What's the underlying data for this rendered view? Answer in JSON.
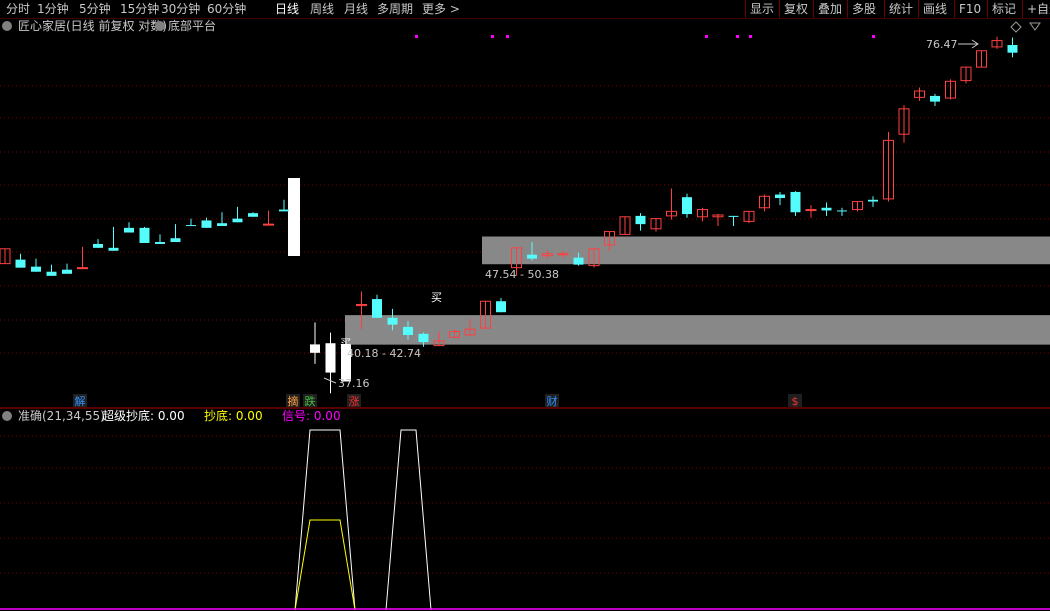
{
  "toolbar": {
    "periods": [
      "分时",
      "1分钟",
      "5分钟",
      "15分钟",
      "30分钟",
      "60分钟",
      "日线",
      "周线",
      "月线",
      "多周期",
      "更多 >"
    ],
    "active_period": "日线",
    "right_buttons": [
      "显示",
      "复权",
      "叠加",
      "多股",
      "统计",
      "画线",
      "F10",
      "标记",
      "+自选"
    ]
  },
  "main_panel": {
    "title": "匠心家居(日线 前复权 对数)",
    "indicator_name": "底部平台",
    "max_label": "76.47",
    "min_label": "37.16",
    "zone_upper_label": "47.54 - 50.38",
    "zone_lower_label": "40.18 - 42.74",
    "buy_marker": "买",
    "event_markers": [
      "解",
      "摘",
      "跌",
      "涨",
      "财",
      "$"
    ]
  },
  "sub_panel": {
    "indicator": "准确(21,34,55)",
    "values": [
      {
        "name": "超级抄底:",
        "value": "0.00",
        "color": "#ffffff"
      },
      {
        "name": "抄底:",
        "value": "0.00",
        "color": "#ffff00"
      },
      {
        "name": "信号:",
        "value": "0.00",
        "color": "#ff00ff"
      }
    ]
  },
  "colors": {
    "up": "#ff4040",
    "down": "#54fcfc",
    "zone": "#888888",
    "magenta": "#ff00ff",
    "grid": "#7a0000",
    "border": "#b00000",
    "cyan": "#54fcfc"
  },
  "chart_data": {
    "type": "candlestick",
    "candles": [
      [
        47.6,
        48.3,
        49.1,
        47.9
      ],
      [
        48.0,
        48.6,
        47.2,
        47.4
      ],
      [
        47.3,
        48.1,
        46.8,
        46.8
      ],
      [
        46.8,
        47.5,
        46.4,
        47.3
      ],
      [
        47.0,
        47.6,
        46.6,
        47.1
      ],
      [
        47.2,
        49.3,
        47.2,
        49.3
      ],
      [
        49.6,
        50.1,
        49.2,
        49.3
      ],
      [
        49.2,
        51.4,
        48.9,
        51.3
      ],
      [
        51.3,
        51.9,
        50.8,
        51.6
      ],
      [
        51.3,
        51.4,
        49.7,
        50.2
      ],
      [
        49.8,
        50.6,
        49.6,
        50.2
      ],
      [
        50.2,
        51.7,
        49.8,
        51.7
      ],
      [
        51.6,
        52.3,
        51.5,
        52.3
      ],
      [
        52.1,
        52.4,
        51.3,
        52.0
      ],
      [
        51.8,
        53.0,
        51.5,
        52.6
      ],
      [
        52.3,
        53.6,
        51.9,
        52.9
      ],
      [
        52.9,
        53.0,
        52.5,
        53.0
      ],
      [
        51.7,
        53.2,
        51.7,
        53.2
      ],
      [
        53.3,
        54.4,
        53.1,
        54.4
      ],
      [
        40.2,
        42.1,
        39.5,
        38.6
      ],
      [
        40.3,
        41.2,
        37.9,
        36.3
      ],
      [
        40.2,
        40.5,
        37.2,
        37.6
      ],
      [
        43.6,
        44.9,
        43.7,
        41.5
      ],
      [
        44.2,
        44.6,
        42.5,
        42.5
      ],
      [
        42.5,
        43.3,
        41.9,
        41.4
      ],
      [
        41.7,
        42.2,
        41.0,
        40.6
      ],
      [
        41.1,
        41.2,
        40.4,
        40.0
      ],
      [
        40.1,
        41.3,
        40.5,
        40.4
      ],
      [
        40.8,
        41.5,
        41.3,
        41.2
      ],
      [
        41.0,
        42.4,
        41.5,
        41.4
      ],
      [
        41.6,
        44.0,
        44.0,
        41.5
      ],
      [
        44.0,
        44.3,
        43.0,
        43.1
      ],
      [
        47.2,
        48.0,
        49.2,
        46.4
      ],
      [
        48.5,
        49.8,
        48.1,
        47.9
      ],
      [
        48.4,
        48.9,
        48.6,
        48.1
      ],
      [
        48.6,
        48.9,
        48.6,
        48.2
      ],
      [
        48.2,
        48.7,
        47.5,
        47.4
      ],
      [
        47.4,
        49.1,
        49.1,
        47.2
      ],
      [
        49.5,
        50.9,
        50.9,
        48.9
      ],
      [
        50.6,
        51.9,
        52.5,
        51.1
      ],
      [
        52.6,
        52.9,
        51.7,
        51.0
      ],
      [
        51.2,
        52.3,
        52.3,
        50.9
      ],
      [
        52.6,
        55.7,
        53.1,
        52.2
      ],
      [
        54.7,
        55.1,
        52.8,
        52.4
      ],
      [
        52.5,
        53.5,
        53.3,
        52.0
      ],
      [
        52.5,
        52.8,
        52.7,
        51.5
      ],
      [
        52.6,
        52.6,
        52.5,
        51.5
      ],
      [
        52.0,
        53.1,
        53.1,
        51.8
      ],
      [
        53.5,
        55.0,
        54.8,
        53.1
      ],
      [
        55.0,
        55.3,
        54.6,
        53.8
      ],
      [
        55.3,
        55.4,
        53.0,
        52.6
      ],
      [
        53.2,
        53.8,
        53.3,
        52.4
      ],
      [
        53.5,
        54.1,
        53.2,
        52.6
      ],
      [
        53.2,
        53.5,
        53.1,
        52.6
      ],
      [
        53.3,
        54.2,
        54.2,
        53.1
      ],
      [
        54.4,
        54.8,
        54.2,
        53.6
      ],
      [
        54.5,
        62.7,
        61.6,
        54.2
      ],
      [
        62.4,
        66.3,
        65.8,
        61.3
      ],
      [
        67.4,
        68.8,
        68.3,
        66.9
      ],
      [
        67.6,
        67.9,
        66.8,
        66.2
      ],
      [
        67.3,
        70.0,
        69.7,
        67.1
      ],
      [
        69.8,
        71.6,
        71.8,
        69.4
      ],
      [
        71.8,
        74.2,
        74.3,
        72.0
      ],
      [
        74.9,
        76.5,
        75.9,
        74.6
      ],
      [
        75.2,
        76.4,
        74.0,
        73.3
      ]
    ],
    "zones": [
      {
        "low": 47.54,
        "high": 50.38
      },
      {
        "low": 40.18,
        "high": 42.74
      }
    ],
    "sub_series": [
      {
        "name": "超级抄底",
        "color": "#ffffff",
        "values": [
          0,
          100,
          100,
          0,
          0,
          100,
          0,
          0
        ]
      },
      {
        "name": "抄底",
        "color": "#ffff00",
        "values": [
          0,
          50,
          50,
          0
        ]
      },
      {
        "name": "信号",
        "color": "#ff00ff",
        "values": [
          0,
          0
        ]
      }
    ]
  }
}
